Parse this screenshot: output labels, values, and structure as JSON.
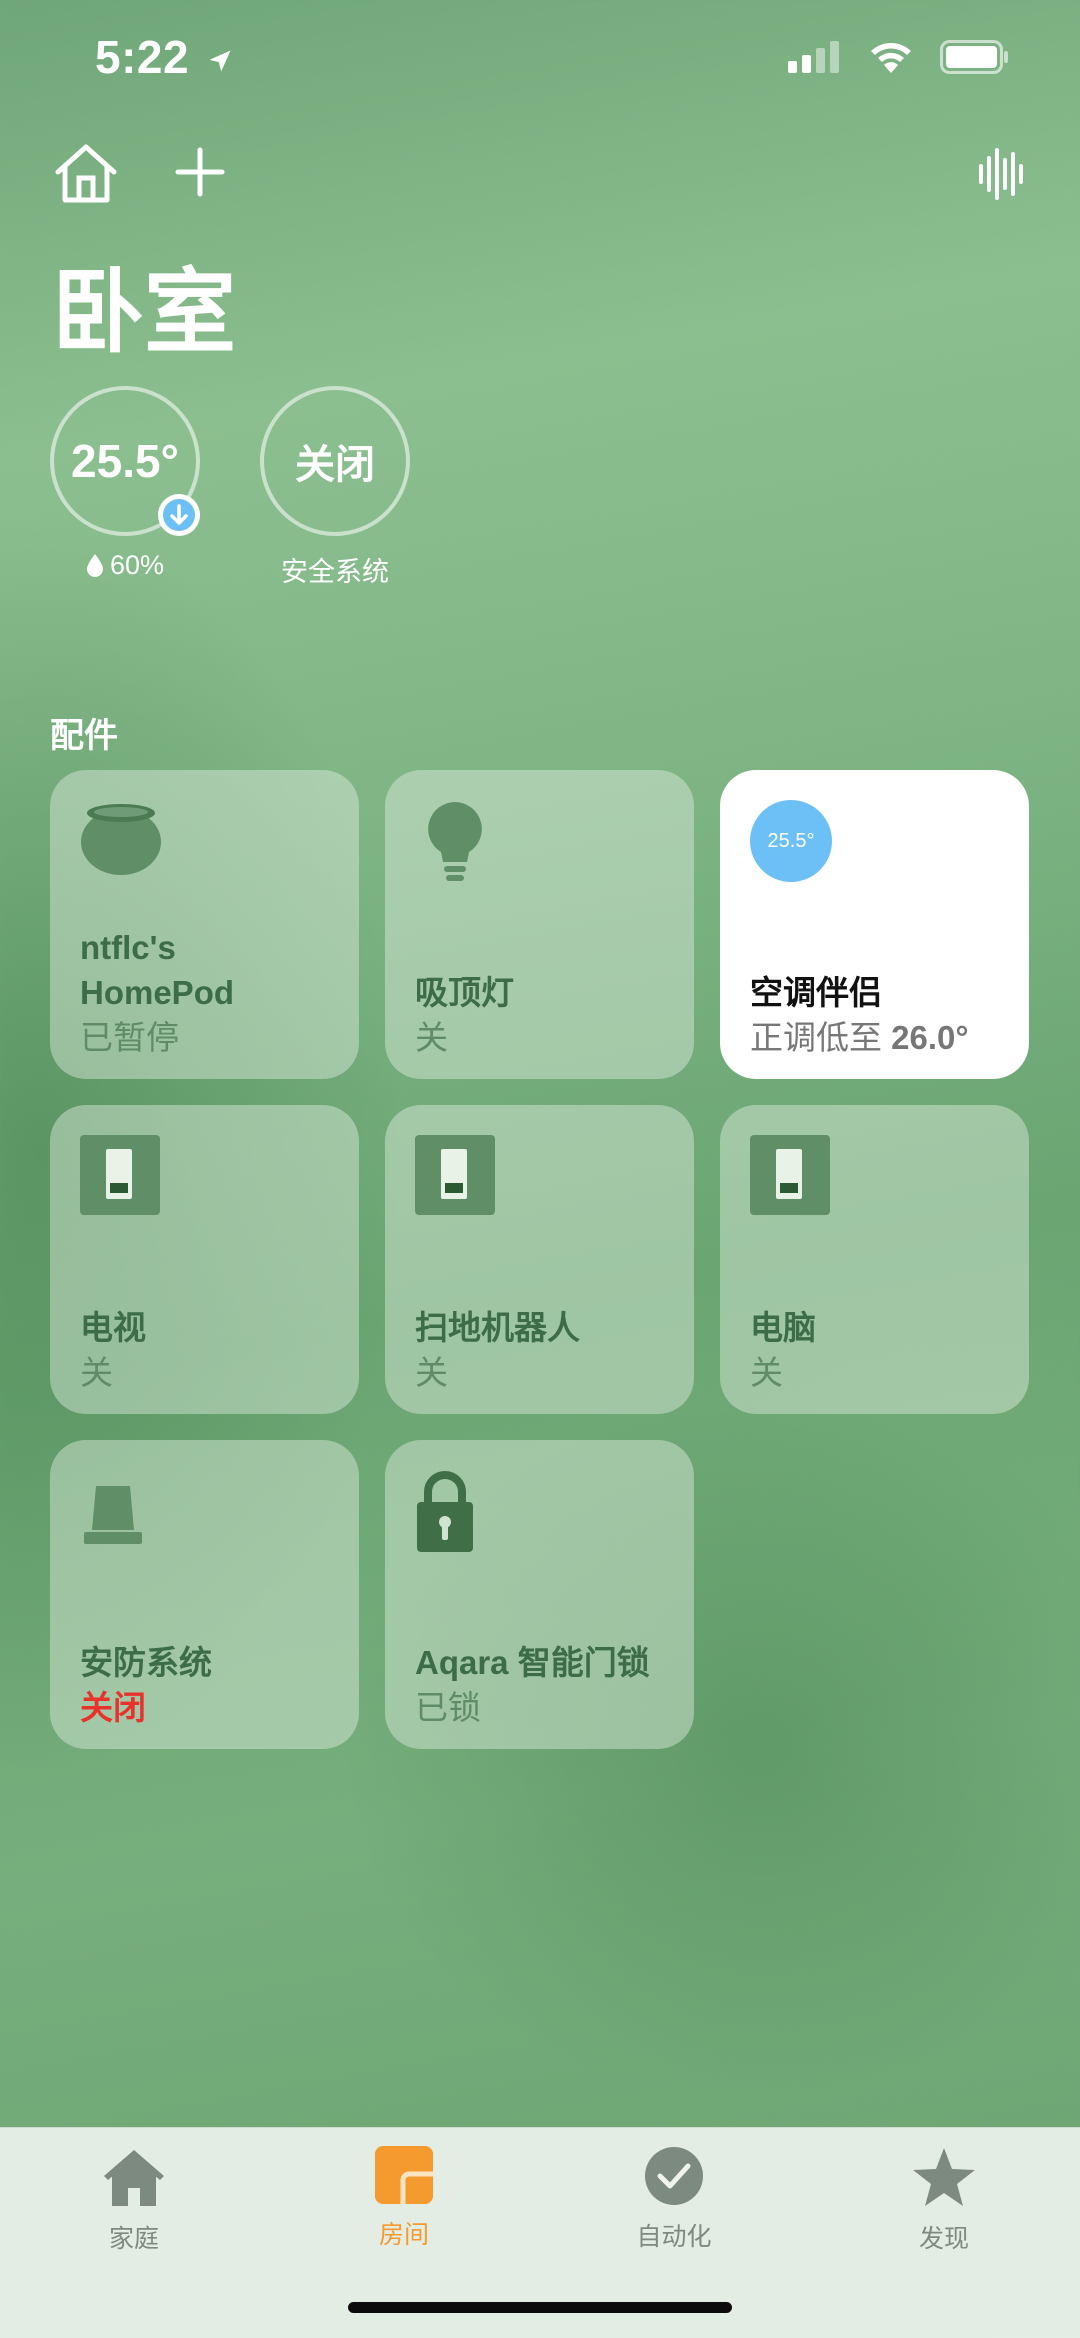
{
  "status_bar": {
    "time": "5:22"
  },
  "header": {
    "room_title": "卧室"
  },
  "status_circles": [
    {
      "value": "25.5°",
      "label": "60%"
    },
    {
      "value": "关闭",
      "label": "安全系统"
    }
  ],
  "section": {
    "title": "配件"
  },
  "tiles": [
    {
      "name": "ntflc's HomePod",
      "state": "已暂停",
      "icon": "homepod-icon"
    },
    {
      "name": "吸顶灯",
      "state": "关",
      "icon": "lightbulb-icon"
    },
    {
      "name": "空调伴侣",
      "state_prefix": "正调低至 ",
      "state_value": "26.0°",
      "badge": "25.5°",
      "icon": "thermostat-icon"
    },
    {
      "name": "电视",
      "state": "关",
      "icon": "switch-icon"
    },
    {
      "name": "扫地机器人",
      "state": "关",
      "icon": "switch-icon"
    },
    {
      "name": "电脑",
      "state": "关",
      "icon": "switch-icon"
    },
    {
      "name": "安防系统",
      "state": "关闭",
      "icon": "alarm-icon"
    },
    {
      "name": "Aqara 智能门锁",
      "state": "已锁",
      "icon": "lock-icon"
    }
  ],
  "tabbar": {
    "items": [
      {
        "label": "家庭",
        "icon": "home-icon",
        "active": false
      },
      {
        "label": "房间",
        "icon": "rooms-icon",
        "active": true
      },
      {
        "label": "自动化",
        "icon": "automation-icon",
        "active": false
      },
      {
        "label": "发现",
        "icon": "star-icon",
        "active": false
      }
    ]
  },
  "colors": {
    "accent": "#f59a2e",
    "alert": "#e8332c",
    "badge": "#6cc0f5"
  }
}
